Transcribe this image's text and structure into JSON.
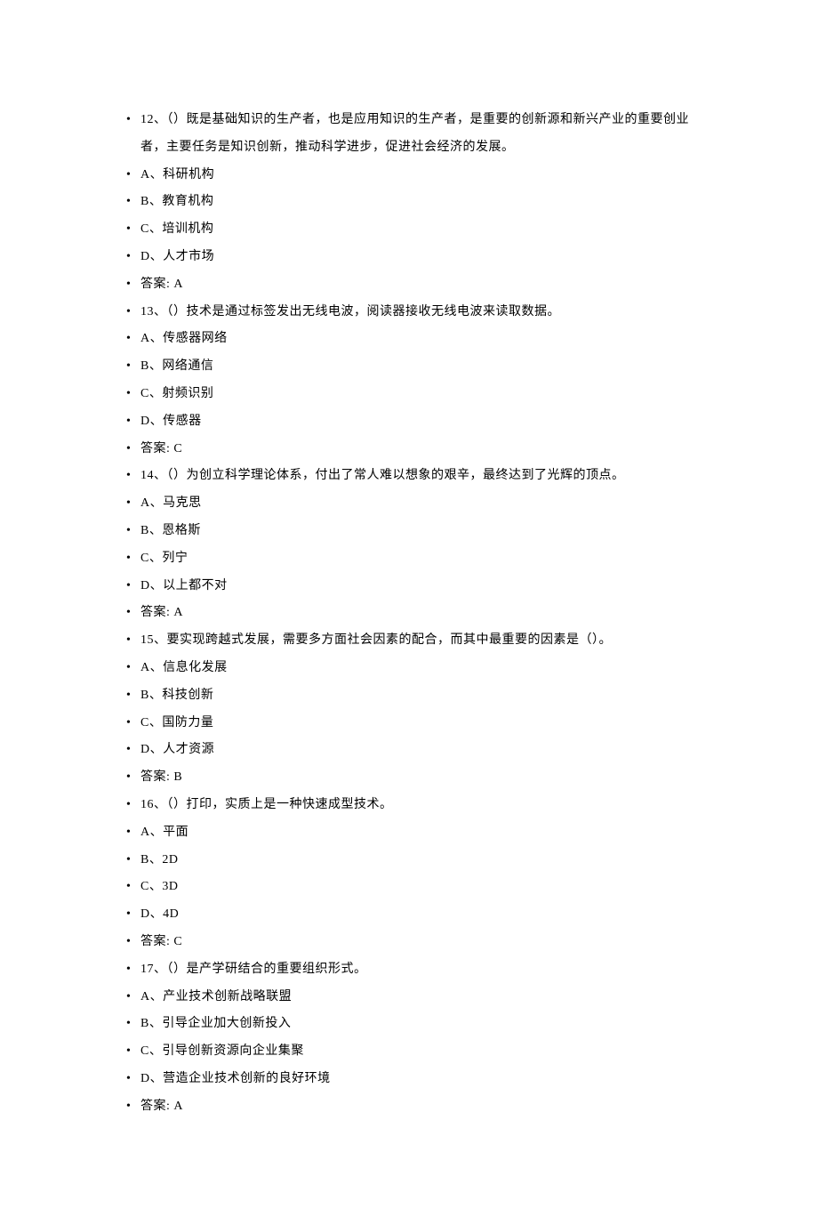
{
  "questions": [
    {
      "stem": "12、（）既是基础知识的生产者，也是应用知识的生产者，是重要的创新源和新兴产业的重要创业者，主要任务是知识创新，推动科学进步，促进社会经济的发展。",
      "options": [
        "A、科研机构",
        "B、教育机构",
        "C、培训机构",
        "D、人才市场"
      ],
      "answer": "答案: A"
    },
    {
      "stem": "13、（）技术是通过标签发出无线电波，阅读器接收无线电波来读取数据。",
      "options": [
        "A、传感器网络",
        "B、网络通信",
        "C、射频识别",
        "D、传感器"
      ],
      "answer": "答案: C"
    },
    {
      "stem": "14、（）为创立科学理论体系，付出了常人难以想象的艰辛，最终达到了光辉的顶点。",
      "options": [
        "A、马克思",
        "B、恩格斯",
        "C、列宁",
        "D、以上都不对"
      ],
      "answer": "答案: A"
    },
    {
      "stem": "15、要实现跨越式发展，需要多方面社会因素的配合，而其中最重要的因素是（）。",
      "options": [
        "A、信息化发展",
        "B、科技创新",
        "C、国防力量",
        "D、人才资源"
      ],
      "answer": "答案: B"
    },
    {
      "stem": "16、（）打印，实质上是一种快速成型技术。",
      "options": [
        "A、平面",
        "B、2D",
        "C、3D",
        "D、4D"
      ],
      "answer": "答案: C"
    },
    {
      "stem": "17、（）是产学研结合的重要组织形式。",
      "options": [
        "A、产业技术创新战略联盟",
        "B、引导企业加大创新投入",
        "C、引导创新资源向企业集聚",
        "D、营造企业技术创新的良好环境"
      ],
      "answer": "答案: A"
    }
  ]
}
